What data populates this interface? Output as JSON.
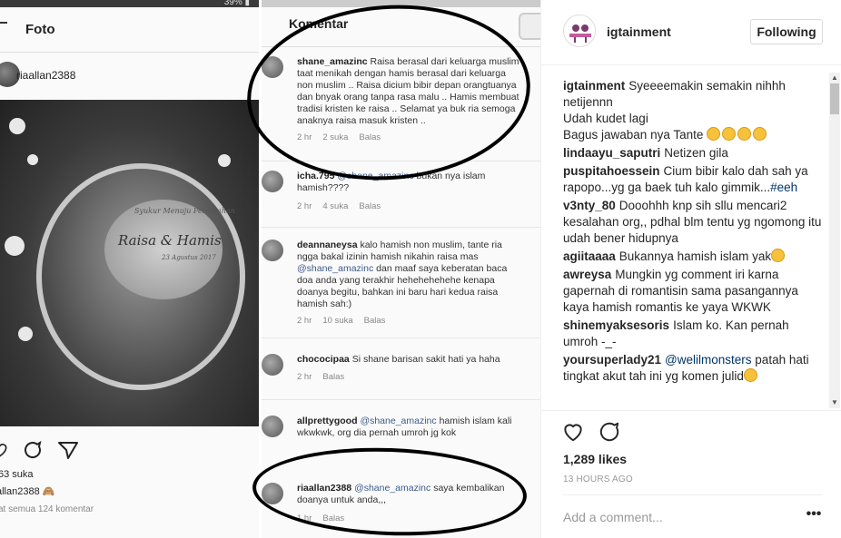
{
  "post_image": {
    "left_phone": {
      "status_text": "39% ▮",
      "title": "Foto",
      "username": "riaallan2388",
      "card_line1": "Syukur Menuju Pernikahan",
      "card_names": "Raisa & Hamis",
      "card_date": "23 Agustus 2017",
      "likes": "63 suka",
      "caption": "allan2388 🙈",
      "view_all": "at semua 124 komentar"
    },
    "right_phone": {
      "title": "Komentar",
      "comments": [
        {
          "user": "shane_amazinc",
          "text": "Raisa berasal dari keluarga muslim taat menikah dengan hamis berasal dari keluarga non muslim .. Raisa dicium bibir depan orangtuanya dan bnyak orang tanpa rasa malu .. Hamis membuat tradisi kristen ke raisa .. Selamat ya buk ria semoga anaknya raisa masuk kristen ..",
          "time": "2 hr",
          "likes": "2 suka",
          "reply": "Balas"
        },
        {
          "user": "icha.795",
          "mention": "@shane_amazinc",
          "text": "bukan nya islam hamish????",
          "time": "2 hr",
          "likes": "4 suka",
          "reply": "Balas"
        },
        {
          "user": "deannaneysa",
          "text": "kalo hamish non muslim, tante ria ngga bakal izinin hamish nikahin raisa mas",
          "mention": "@shane_amazinc",
          "text2": "dan maaf saya keberatan baca doa anda yang terakhir hehehehehehe kenapa doanya begitu, bahkan ini baru hari kedua raisa hamish sah:)",
          "time": "2 hr",
          "likes": "10 suka",
          "reply": "Balas"
        },
        {
          "user": "chococipaa",
          "text": "Si shane barisan sakit hati ya haha",
          "time": "2 hr",
          "reply": "Balas"
        },
        {
          "user": "allprettygood",
          "mention": "@shane_amazinc",
          "text": "hamish islam kali wkwkwk, org dia pernah umroh jg kok",
          "time": "",
          "reply": ""
        },
        {
          "user": "riaallan2388",
          "mention": "@shane_amazinc",
          "text": "saya kembalikan doanya untuk anda,,,",
          "time": "1 hr",
          "reply": "Balas"
        }
      ]
    }
  },
  "sidebar": {
    "header": {
      "username": "igtainment",
      "follow_label": "Following"
    },
    "comments": [
      {
        "user": "igtainment",
        "text": "Syeeeemakin semakin nihhh netijennn",
        "line2": "Udah kudet lagi",
        "line3": "Bagus jawaban nya Tante",
        "emoji_count": 4
      },
      {
        "user": "lindaayu_saputri",
        "text": "Netizen gila"
      },
      {
        "user": "puspitahoessein",
        "text": "Cium bibir kalo dah sah ya rapopo...yg ga baek tuh kalo gimmik...",
        "hashtag": "#eeh"
      },
      {
        "user": "v3nty_80",
        "text": "Dooohhh knp sih sllu mencari2 kesalahan org,, pdhal blm tentu yg ngomong itu udah bener hidupnya"
      },
      {
        "user": "agiitaaaa",
        "text": "Bukannya hamish islam yak"
      },
      {
        "user": "awreysa",
        "text": "Mungkin yg comment iri karna gapernah di romantisin sama pasangannya kaya hamish romantis ke yaya WKWK"
      },
      {
        "user": "shinemyaksesoris",
        "text": "Islam ko. Kan pernah umroh -_-"
      },
      {
        "user": "yoursuperlady21",
        "mention": "@welilmonsters",
        "text": "patah hati tingkat akut tah ini yg komen julid"
      }
    ],
    "likes": "1,289 likes",
    "time": "13 HOURS AGO",
    "comment_placeholder": "Add a comment...",
    "more_label": "•••"
  }
}
